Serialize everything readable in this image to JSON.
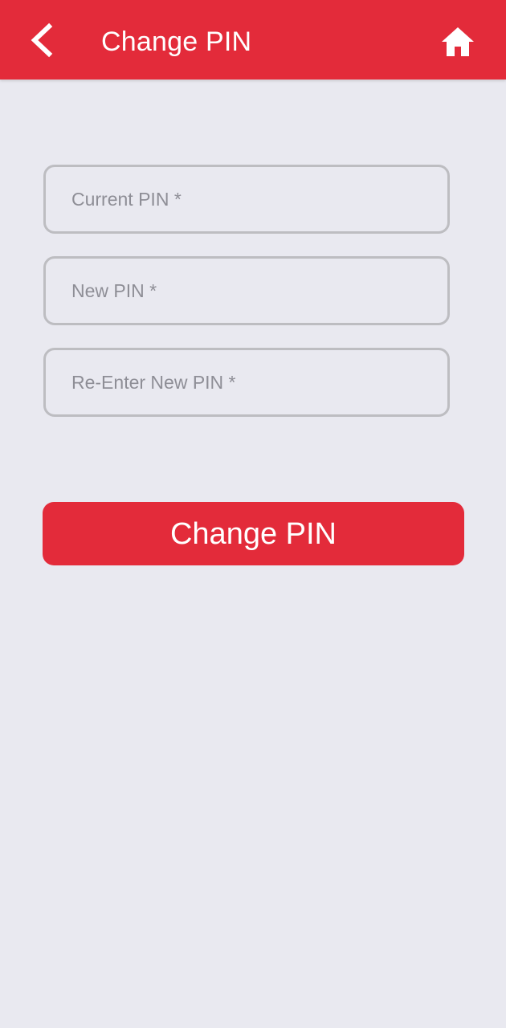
{
  "header": {
    "title": "Change PIN",
    "back_icon": "chevron-left-icon",
    "home_icon": "home-icon",
    "background_color": "#E32B3A"
  },
  "form": {
    "current_pin": {
      "placeholder": "Current PIN *",
      "value": ""
    },
    "new_pin": {
      "placeholder": "New PIN *",
      "value": ""
    },
    "reenter_pin": {
      "placeholder": "Re-Enter New PIN *",
      "value": ""
    },
    "submit_label": "Change PIN"
  },
  "colors": {
    "accent": "#E32B3A",
    "page_background": "#E9E9F0",
    "field_border": "#BDBDC1",
    "placeholder_text": "#8E8E96"
  }
}
